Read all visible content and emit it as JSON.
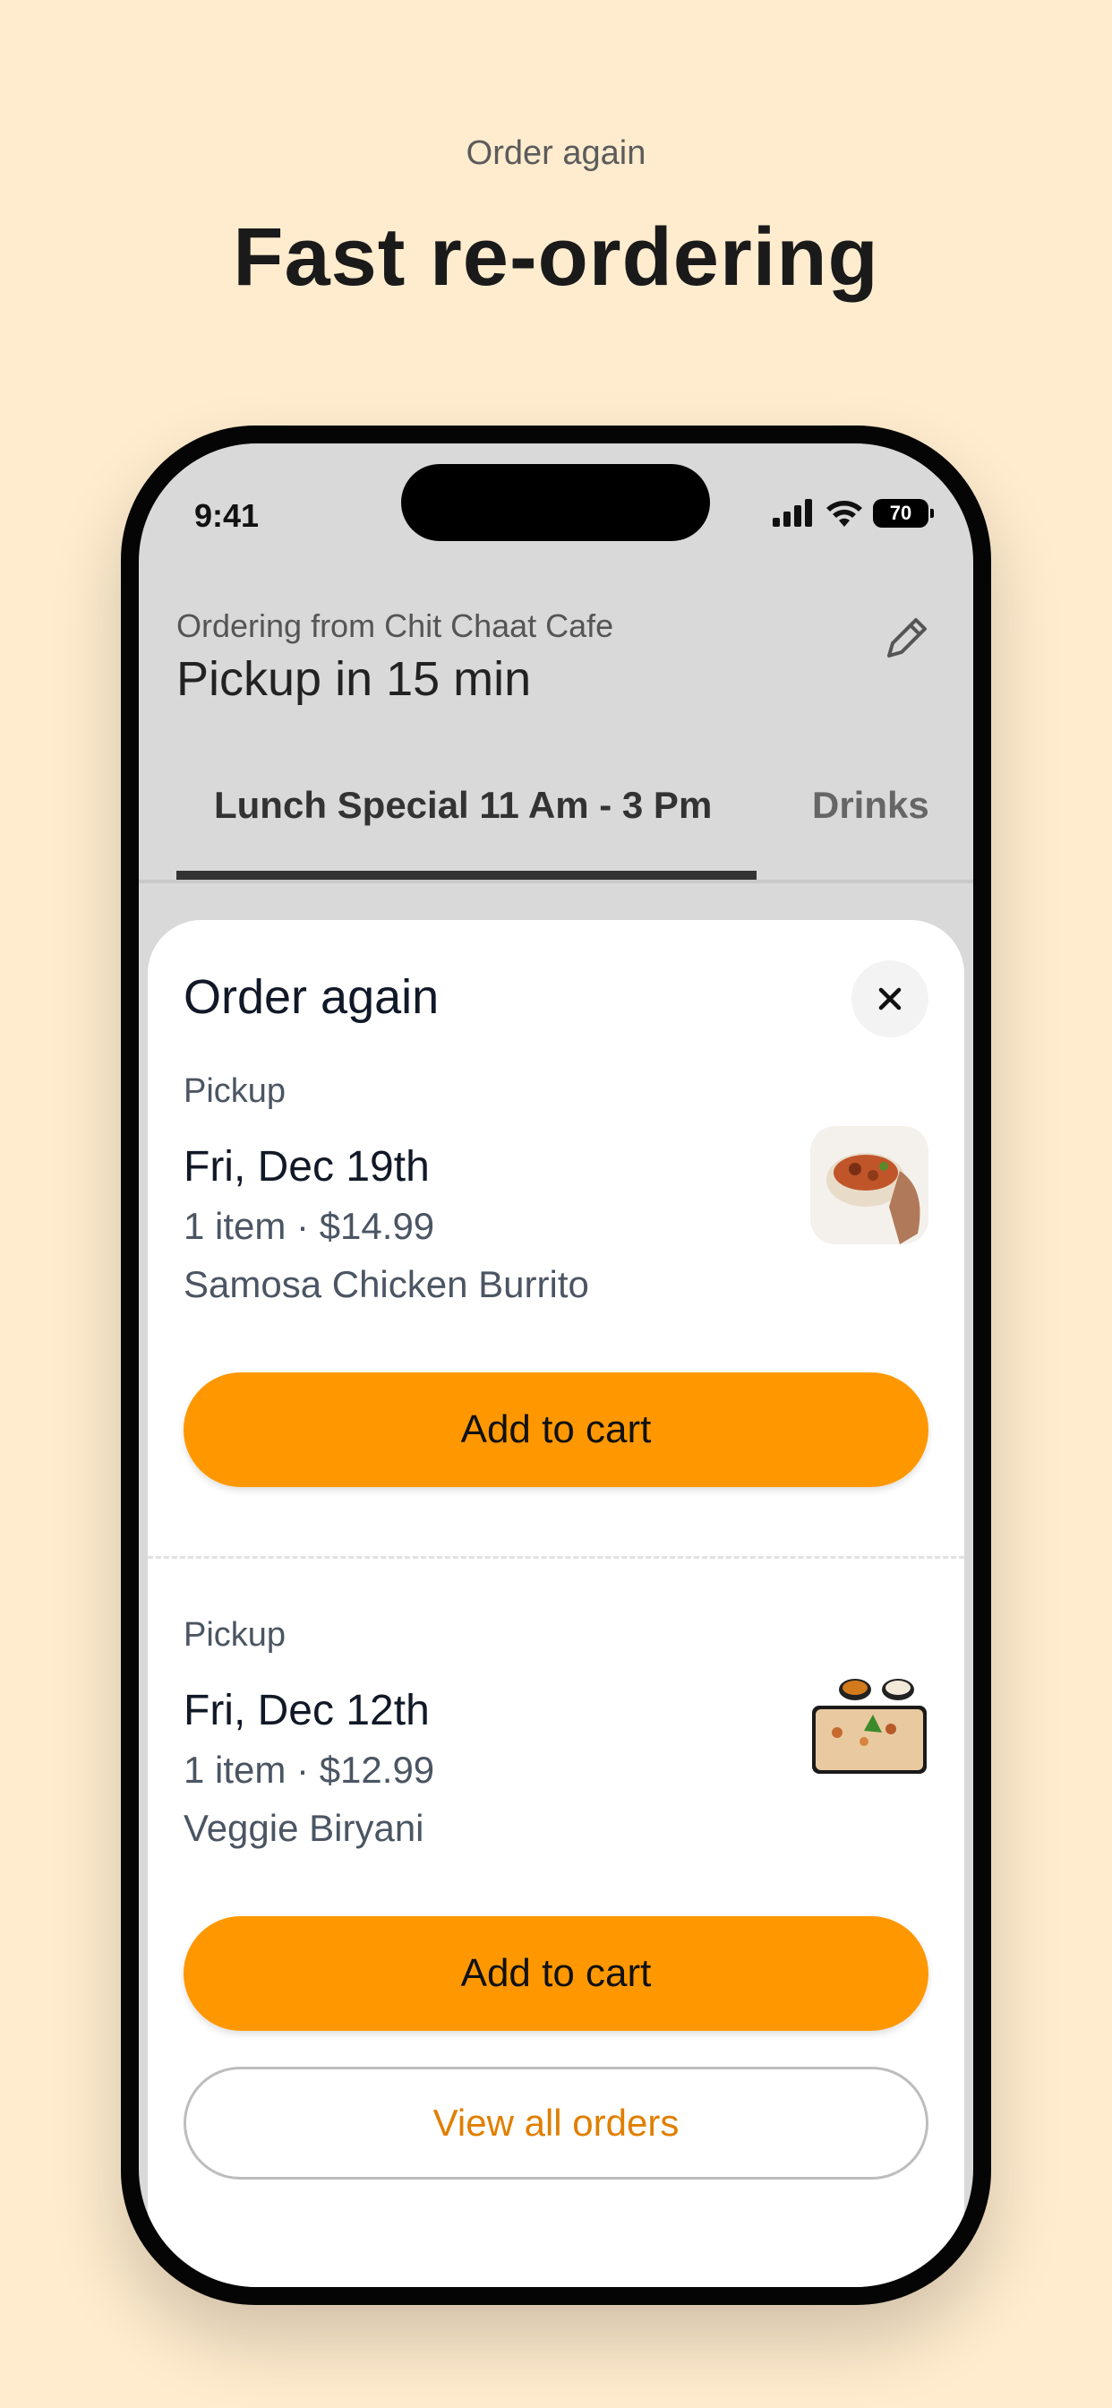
{
  "page": {
    "eyebrow": "Order again",
    "headline": "Fast re-ordering"
  },
  "status_bar": {
    "time": "9:41",
    "battery": "70",
    "icons": [
      "signal-icon",
      "wifi-icon",
      "battery-icon"
    ]
  },
  "header": {
    "ordering_from": "Ordering from Chit Chaat Cafe",
    "pickup_time": "Pickup in 15 min",
    "edit_icon": "pencil-icon"
  },
  "tabs": [
    {
      "label": "Lunch Special 11 Am - 3 Pm",
      "active": true
    },
    {
      "label": "Drinks",
      "active": false
    }
  ],
  "sheet": {
    "title": "Order again",
    "close_icon": "close-icon",
    "orders": [
      {
        "type": "Pickup",
        "date": "Fri, Dec 19th",
        "meta": "1 item · $14.99",
        "item": "Samosa Chicken Burrito",
        "button": "Add to cart"
      },
      {
        "type": "Pickup",
        "date": "Fri, Dec 12th",
        "meta": "1 item · $12.99",
        "item": "Veggie Biryani",
        "button": "Add to cart"
      }
    ],
    "view_all": "View all orders"
  },
  "colors": {
    "background": "#ffecce",
    "accent": "#ff9800",
    "link": "#e07f00"
  }
}
